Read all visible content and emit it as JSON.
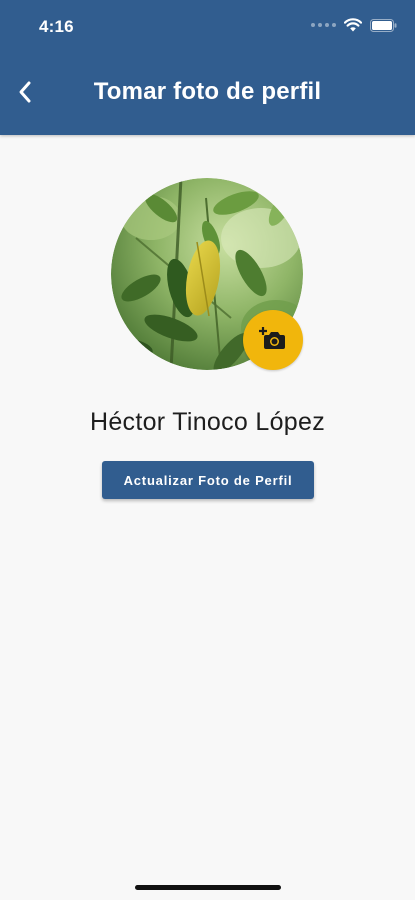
{
  "status_bar": {
    "time": "4:16",
    "wifi_icon": "wifi-icon",
    "battery_icon": "battery-icon"
  },
  "nav": {
    "title": "Tomar foto de perfil",
    "back_icon": "chevron-left-icon"
  },
  "profile": {
    "name": "Héctor Tinoco López",
    "avatar_icon": "leaf-photo",
    "camera_icon": "camera-add-icon"
  },
  "actions": {
    "update_label": "Actualizar Foto de Perfil"
  },
  "colors": {
    "primary": "#315d8f",
    "accent": "#f1b60c",
    "background": "#f8f8f8"
  }
}
